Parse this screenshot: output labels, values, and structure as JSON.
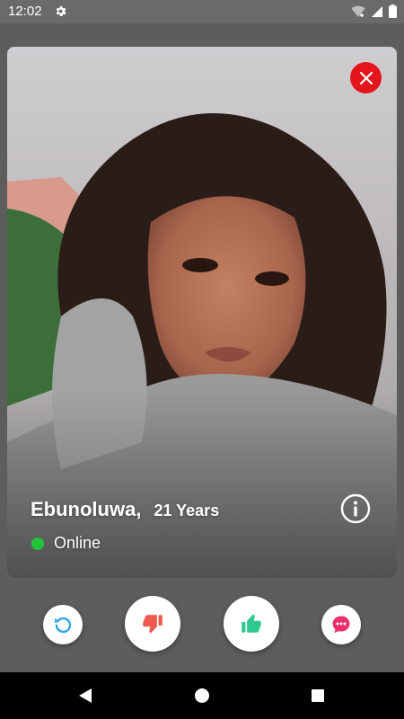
{
  "status_bar": {
    "time": "12:02",
    "icons": [
      "gear-icon",
      "wifi-icon",
      "signal-icon",
      "battery-icon"
    ]
  },
  "profile": {
    "name": "Ebunoluwa,",
    "age": "21 Years",
    "status": "Online",
    "status_color": "#23c33a"
  },
  "card_icons": {
    "close": "close-icon",
    "info": "info-icon"
  },
  "actions": [
    {
      "icon": "undo-icon",
      "color": "#2ea6e6"
    },
    {
      "icon": "thumbs-down-icon",
      "color": "#ef5a50"
    },
    {
      "icon": "thumbs-up-icon",
      "color": "#2fc990"
    },
    {
      "icon": "chat-icon",
      "color": "#ea2f6e"
    }
  ],
  "colors": {
    "close": "#e4161c",
    "background": "#5d5d5b"
  },
  "nav": {
    "icons": [
      "back-icon",
      "home-icon",
      "recents-icon"
    ]
  }
}
